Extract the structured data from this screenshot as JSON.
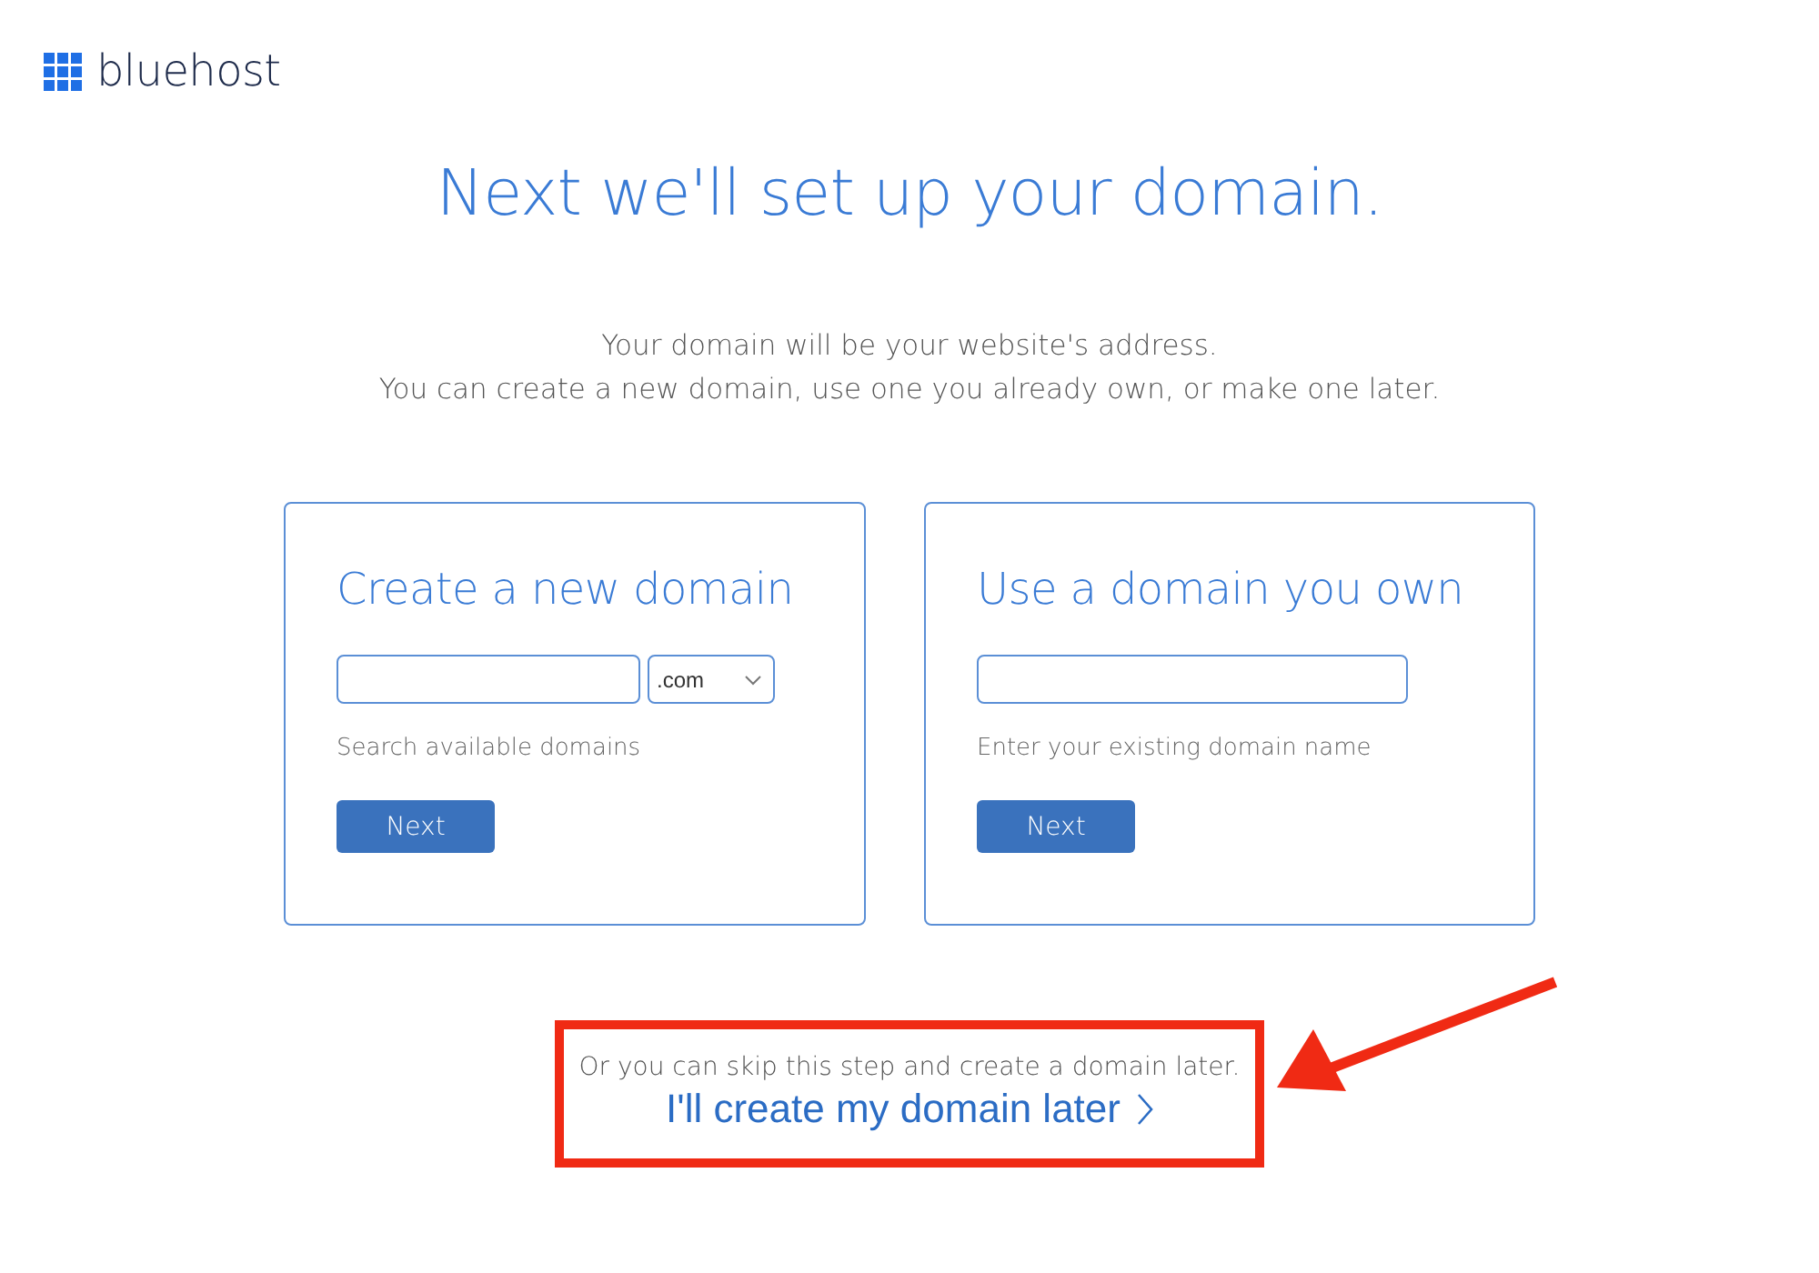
{
  "logo": {
    "text": "bluehost"
  },
  "heading": "Next we'll set up your domain.",
  "intro": [
    "Your domain will be your website's address.",
    "You can create a new domain, use one you already own, or make one later."
  ],
  "cards": [
    {
      "kind": "search",
      "title": "Create a new domain",
      "extension": ".com",
      "hint": "Search available domains",
      "button": "Next"
    },
    {
      "kind": "existing",
      "title": "Use a domain you own",
      "hint": "Enter your existing domain name",
      "button": "Next"
    }
  ],
  "skip": {
    "text": "Or you can skip this step and create a domain later.",
    "link": "I'll create my domain later"
  }
}
